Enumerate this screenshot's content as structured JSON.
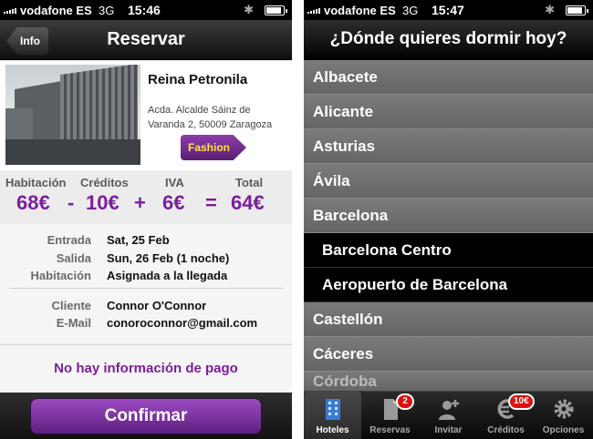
{
  "left": {
    "status": {
      "carrier": "vodafone ES",
      "network": "3G",
      "time": "15:46"
    },
    "nav": {
      "back_label": "Info",
      "title": "Reservar"
    },
    "hotel": {
      "name": "Reina Petronila",
      "address": "Acda. Alcalde Sáinz de Varanda 2, 50009 Zaragoza",
      "tag": "Fashion"
    },
    "price": {
      "labels": [
        "Habitación",
        "Créditos",
        "IVA",
        "Total"
      ],
      "values": [
        "68€",
        "10€",
        "6€",
        "64€"
      ],
      "ops": [
        "-",
        "+",
        "="
      ]
    },
    "details": [
      {
        "key": "Entrada",
        "value": "Sat, 25 Feb"
      },
      {
        "key": "Salida",
        "value": "Sun, 26 Feb (1 noche)"
      },
      {
        "key": "Habitación",
        "value": "Asignada a la llegada"
      },
      {
        "key": "Cliente",
        "value": "Connor O'Connor"
      },
      {
        "key": "E-Mail",
        "value": "conoroconnor@gmail.com"
      }
    ],
    "payment_note": "No hay información de pago",
    "confirm_label": "Confirmar"
  },
  "right": {
    "status": {
      "carrier": "vodafone ES",
      "network": "3G",
      "time": "15:47"
    },
    "nav": {
      "title": "¿Dónde quieres dormir hoy?"
    },
    "cities": [
      {
        "label": "Albacete",
        "sub": false
      },
      {
        "label": "Alicante",
        "sub": false
      },
      {
        "label": "Asturias",
        "sub": false
      },
      {
        "label": "Ávila",
        "sub": false
      },
      {
        "label": "Barcelona",
        "sub": false
      },
      {
        "label": "Barcelona Centro",
        "sub": true
      },
      {
        "label": "Aeropuerto de Barcelona",
        "sub": true
      },
      {
        "label": "Castellón",
        "sub": false
      },
      {
        "label": "Cáceres",
        "sub": false
      },
      {
        "label": "Córdoba",
        "sub": false
      }
    ],
    "tabs": [
      {
        "label": "Hoteles",
        "icon": "building-icon",
        "active": true,
        "badge": ""
      },
      {
        "label": "Reservas",
        "icon": "document-icon",
        "active": false,
        "badge": "2"
      },
      {
        "label": "Invitar",
        "icon": "add-person-icon",
        "active": false,
        "badge": ""
      },
      {
        "label": "Créditos",
        "icon": "euro-icon",
        "active": false,
        "badge": "10€"
      },
      {
        "label": "Opciones",
        "icon": "gear-icon",
        "active": false,
        "badge": ""
      }
    ]
  },
  "colors": {
    "accent": "#7b1e9e",
    "tag_text": "#ffe24a",
    "badge": "#dd1111"
  }
}
